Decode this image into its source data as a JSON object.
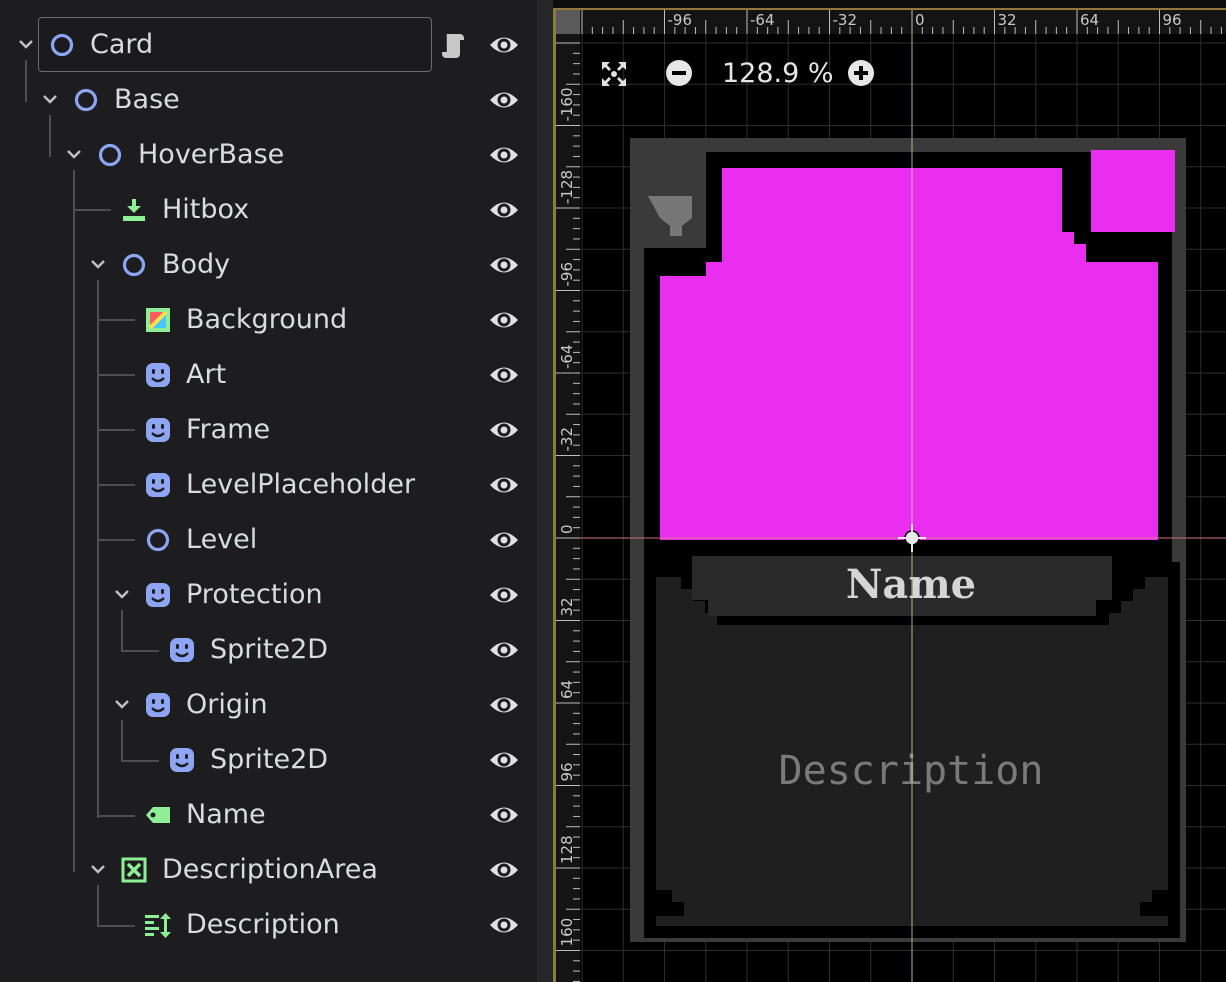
{
  "scene_tree": {
    "nodes": [
      {
        "name": "Card",
        "icon": "node2d-icon",
        "expanded": true,
        "selected": true,
        "has_script": true
      },
      {
        "name": "Base",
        "icon": "node2d-icon",
        "expanded": true
      },
      {
        "name": "HoverBase",
        "icon": "node2d-icon",
        "expanded": true
      },
      {
        "name": "Hitbox",
        "icon": "area2d-icon"
      },
      {
        "name": "Body",
        "icon": "node2d-icon",
        "expanded": true
      },
      {
        "name": "Background",
        "icon": "colorrect-icon"
      },
      {
        "name": "Art",
        "icon": "sprite2d-icon"
      },
      {
        "name": "Frame",
        "icon": "sprite2d-icon"
      },
      {
        "name": "LevelPlaceholder",
        "icon": "sprite2d-icon"
      },
      {
        "name": "Level",
        "icon": "node2d-icon"
      },
      {
        "name": "Protection",
        "icon": "sprite2d-icon",
        "expanded": true
      },
      {
        "name": "Sprite2D",
        "icon": "sprite2d-icon"
      },
      {
        "name": "Origin",
        "icon": "sprite2d-icon",
        "expanded": true
      },
      {
        "name": "Sprite2D",
        "icon": "sprite2d-icon"
      },
      {
        "name": "Name",
        "icon": "label-icon"
      },
      {
        "name": "DescriptionArea",
        "icon": "container-icon",
        "expanded": true
      },
      {
        "name": "Description",
        "icon": "richtextlabel-icon"
      }
    ]
  },
  "viewport": {
    "zoom_label": "128.9 %",
    "ruler_top": [
      "-96",
      "-64",
      "-32",
      "0",
      "32",
      "64",
      "96"
    ],
    "ruler_left": [
      "-160",
      "-128",
      "-96",
      "-64",
      "-32",
      "0",
      "32",
      "64",
      "96",
      "128",
      "160"
    ],
    "card_name": "Name",
    "card_description": "Description",
    "colors": {
      "placeholder": "#ea2ef0",
      "accent": "#8da5f3",
      "guide": "#cbdc8a"
    }
  }
}
